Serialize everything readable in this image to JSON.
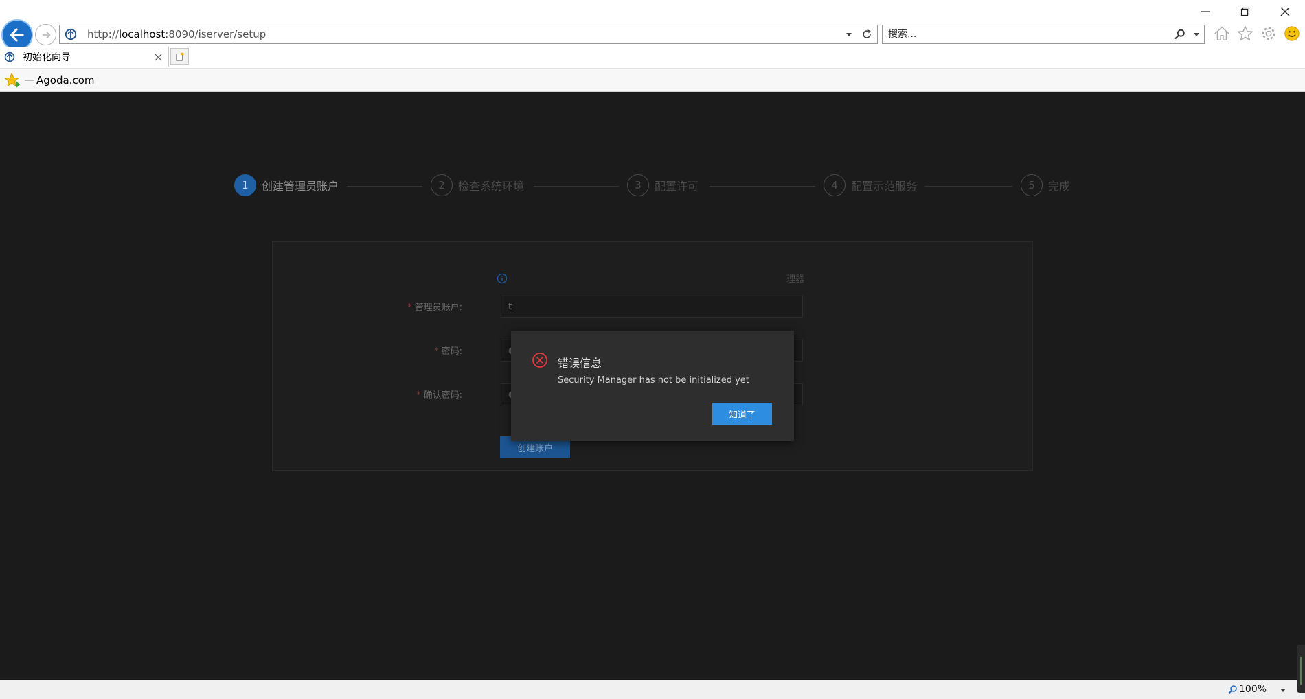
{
  "browser": {
    "url_prefix": "http://",
    "url_host": "localhost",
    "url_rest": ":8090/iserver/setup",
    "search_placeholder": "搜索...",
    "tab_title": "初始化向导",
    "favorite_label": "Agoda.com",
    "zoom": "100%",
    "accent": "#1c6fc7"
  },
  "wizard": {
    "steps": [
      {
        "num": "1",
        "label": "创建管理员账户",
        "active": true
      },
      {
        "num": "2",
        "label": "检查系统环境",
        "active": false
      },
      {
        "num": "3",
        "label": "配置许可",
        "active": false
      },
      {
        "num": "4",
        "label": "配置示范服务",
        "active": false
      },
      {
        "num": "5",
        "label": "完成",
        "active": false
      }
    ],
    "hint_tail": "理器",
    "form": {
      "admin_label": "管理员账户:",
      "admin_value": "t",
      "password_label": "密码:",
      "password_value": "●●●●●●●●●",
      "confirm_label": "确认密码:",
      "confirm_value": "●●●●●●●●●",
      "submit_label": "创建账户",
      "required_mark": "*"
    }
  },
  "dialog": {
    "title": "错误信息",
    "message": "Security Manager has not be initialized yet",
    "ok_label": "知道了",
    "error_color": "#e0383e",
    "button_color": "#2d8de0"
  }
}
